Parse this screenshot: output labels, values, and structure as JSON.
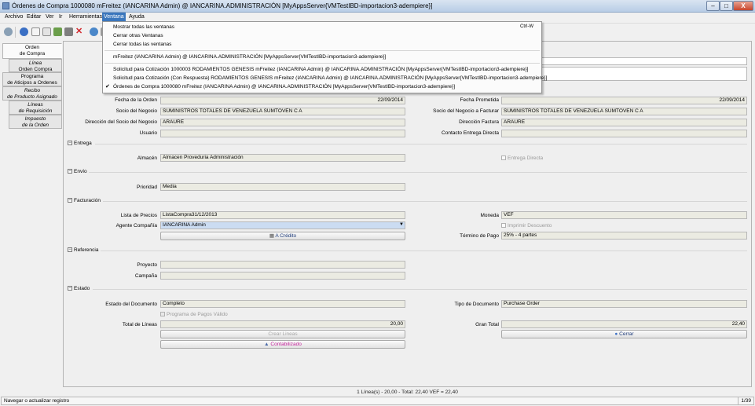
{
  "window": {
    "title": "Órdenes de Compra  1000080  mFreitez (IANCARINA Admin) @ IANCARINA.ADMINISTRACIÓN [MyAppsServer{VMTestIBD-importacion3-adempiere}]",
    "min": "–",
    "max": "□",
    "close": "X"
  },
  "menubar": {
    "archivo": "Archivo",
    "editar": "Editar",
    "ver": "Ver",
    "ir": "Ir",
    "herramientas": "Herramientas",
    "ventana": "Ventana",
    "ayuda": "Ayuda"
  },
  "ventana_menu": {
    "show_all": "Mostrar todas las ventanas",
    "show_all_shortcut": "Ctrl-W",
    "close_others": "Cerrar otras Ventanas",
    "close_all": "Cerrar todas las ventanas",
    "win1": "mFreitez (IANCARINA Admin) @ IANCARINA.ADMINISTRACIÓN [MyAppsServer{VMTestIBD-importacion3-adempiere}]",
    "win2": "Solicitud para Cotización  1000003  RODAMIENTOS GENESIS  mFreitez (IANCARINA Admin) @ IANCARINA.ADMINISTRACIÓN [MyAppsServer{VMTestIBD-importacion3-adempiere}]",
    "win3": "Solicitud para Cotización (Con Respuesta)  RODAMIENTOS GENESIS  mFreitez (IANCARINA Admin) @ IANCARINA.ADMINISTRACIÓN [MyAppsServer{VMTestIBD-importacion3-adempiere}]",
    "win4": "Órdenes de Compra  1000080  mFreitez (IANCARINA Admin) @ IANCARINA.ADMINISTRACIÓN [MyAppsServer{VMTestIBD-importacion3-adempiere}]",
    "check": "✔"
  },
  "tabs": {
    "t1a": "Orden",
    "t1b": "de Compra",
    "t2a": "Línea",
    "t2b": "Orden Compra",
    "t3a": "Programa",
    "t3b": "de Aticipos a Ordenes",
    "t4a": "Recibo",
    "t4b": "de Producto Asignado",
    "t5a": "Líneas",
    "t5b": "de Requisición",
    "t6a": "Impuesto",
    "t6b": "de la Orden"
  },
  "header": {
    "fecha_orden_label": "Fecha de la Orden",
    "fecha_orden": "22/09/2014",
    "fecha_prometida_label": "Fecha Prometida",
    "fecha_prometida": "22/09/2014",
    "socio_label": "Socio del Negocio",
    "socio": "SUMINISTROS TOTALES DE VENEZUELA SUMTOVEN  C A",
    "socio_facturar_label": "Socio del Negocio a Facturar",
    "socio_facturar": "SUMINISTROS TOTALES DE VENEZUELA SUMTOVEN  C A",
    "direccion_label": "Dirección del Socio del Negocio",
    "direccion": "ARAURE",
    "direccion_factura_label": "Dirección Factura",
    "direccion_factura": "ARAURE",
    "usuario_label": "Usuario",
    "usuario": "",
    "contacto_label": "Contacto Entrega Directa",
    "contacto": ""
  },
  "entrega": {
    "title": "Entrega",
    "almacen_label": "Almacén",
    "almacen": "Almacen Proveduria Administración",
    "entrega_directa": "Entrega Directa"
  },
  "envio": {
    "title": "Envío",
    "prioridad_label": "Prioridad",
    "prioridad": "Media"
  },
  "facturacion": {
    "title": "Facturación",
    "lista_label": "Lista de Precios",
    "lista": "ListaCompra31/12/2013",
    "moneda_label": "Moneda",
    "moneda": "VEF",
    "agente_label": "Agente Compañía",
    "agente": "IANCARINA Admin",
    "imprimir_descuento": "Imprimir Descuento",
    "a_credito": "A Crédito",
    "termino_label": "Término de Pago",
    "termino": "25% - 4 partes"
  },
  "referencia": {
    "title": "Referencia",
    "proyecto_label": "Proyecto",
    "proyecto": "",
    "campana_label": "Campaña",
    "campana": ""
  },
  "estado": {
    "title": "Estado",
    "estado_doc_label": "Estado del Documento",
    "estado_doc": "Completo",
    "tipo_doc_label": "Tipo de Documento",
    "tipo_doc": "Purchase Order",
    "programa_pagos": "Programa de Pagos Válido",
    "total_lineas_label": "Total de Líneas",
    "total_lineas": "20,00",
    "gran_total_label": "Gran Total",
    "gran_total": "22,40",
    "crear_lineas": "Crear Lineas",
    "cerrar": "Cerrar",
    "contabilizado": "Contabilizado"
  },
  "footer": {
    "summary": "1 Línea(s) - 20,00 -  Total: 22,40  VEF = 22,40",
    "status": "Navegar o actualizar registro",
    "pages": "1/39"
  },
  "colors": {
    "menu_active": "#3b77bd",
    "field_bg": "#ebebe2",
    "selected_field": "#cbdcf2"
  }
}
